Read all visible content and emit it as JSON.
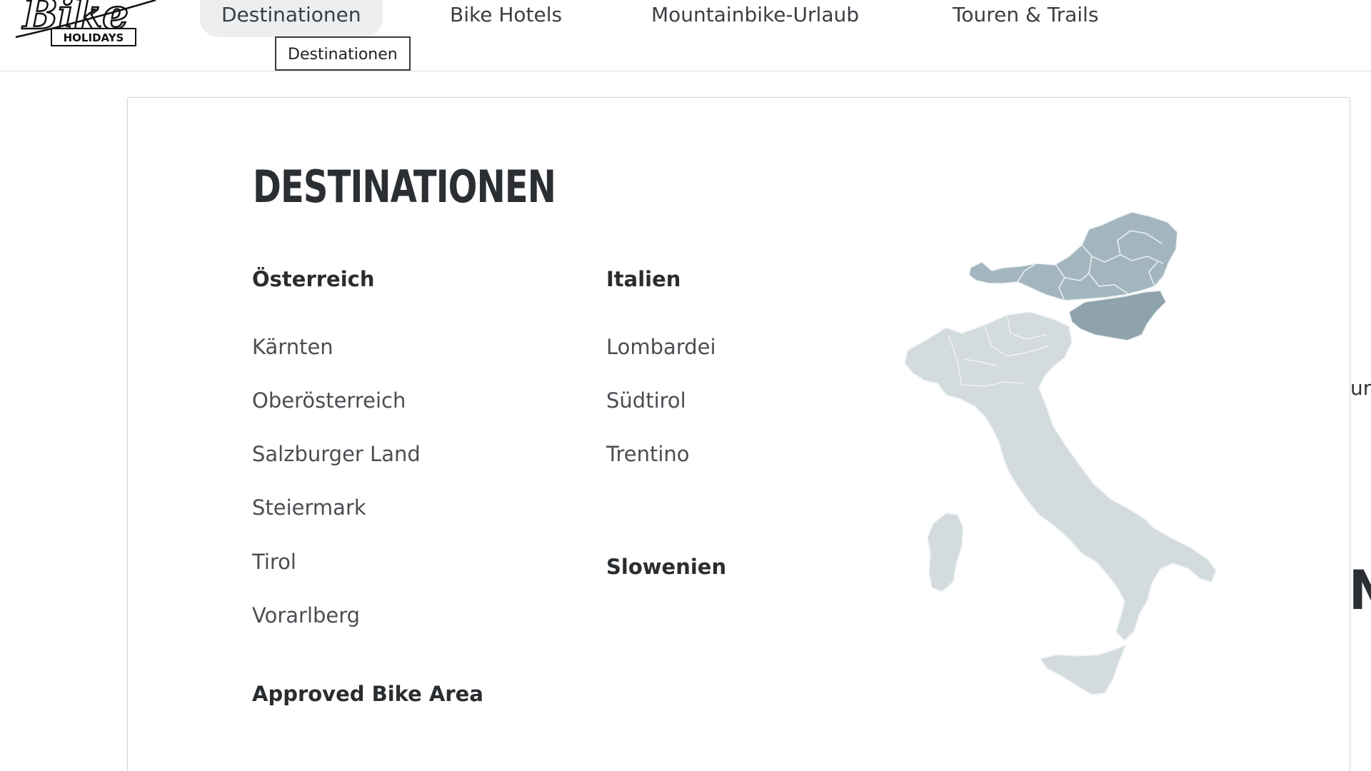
{
  "brand": {
    "logo_script": "Bike",
    "logo_sub": "HOLIDAYS"
  },
  "nav": {
    "items": [
      {
        "label": "Destinationen",
        "active": true
      },
      {
        "label": "Bike Hotels",
        "active": false
      },
      {
        "label": "Mountainbike-Urlaub",
        "active": false
      },
      {
        "label": "Touren & Trails",
        "active": false
      }
    ],
    "tooltip": "Destinationen"
  },
  "menu": {
    "title": "DESTINATIONEN",
    "austria": {
      "heading": "Österreich",
      "links": [
        "Kärnten",
        "Oberösterreich",
        "Salzburger Land",
        "Steiermark",
        "Tirol",
        "Vorarlberg"
      ]
    },
    "approved": {
      "heading": "Approved Bike Area"
    },
    "italy": {
      "heading": "Italien",
      "links": [
        "Lombardei",
        "Südtirol",
        "Trentino"
      ]
    },
    "slovenia": {
      "heading": "Slowenien"
    }
  },
  "background_page": {
    "edge_text": "ur",
    "edge_heading": "N"
  },
  "colors": {
    "italy_fill": "#d3dbde",
    "austria_fill": "#a3b6bf",
    "slovenia_fill": "#8ea3ac",
    "region_border": "#eef2f3",
    "nav_active_bg": "#eceef0"
  }
}
